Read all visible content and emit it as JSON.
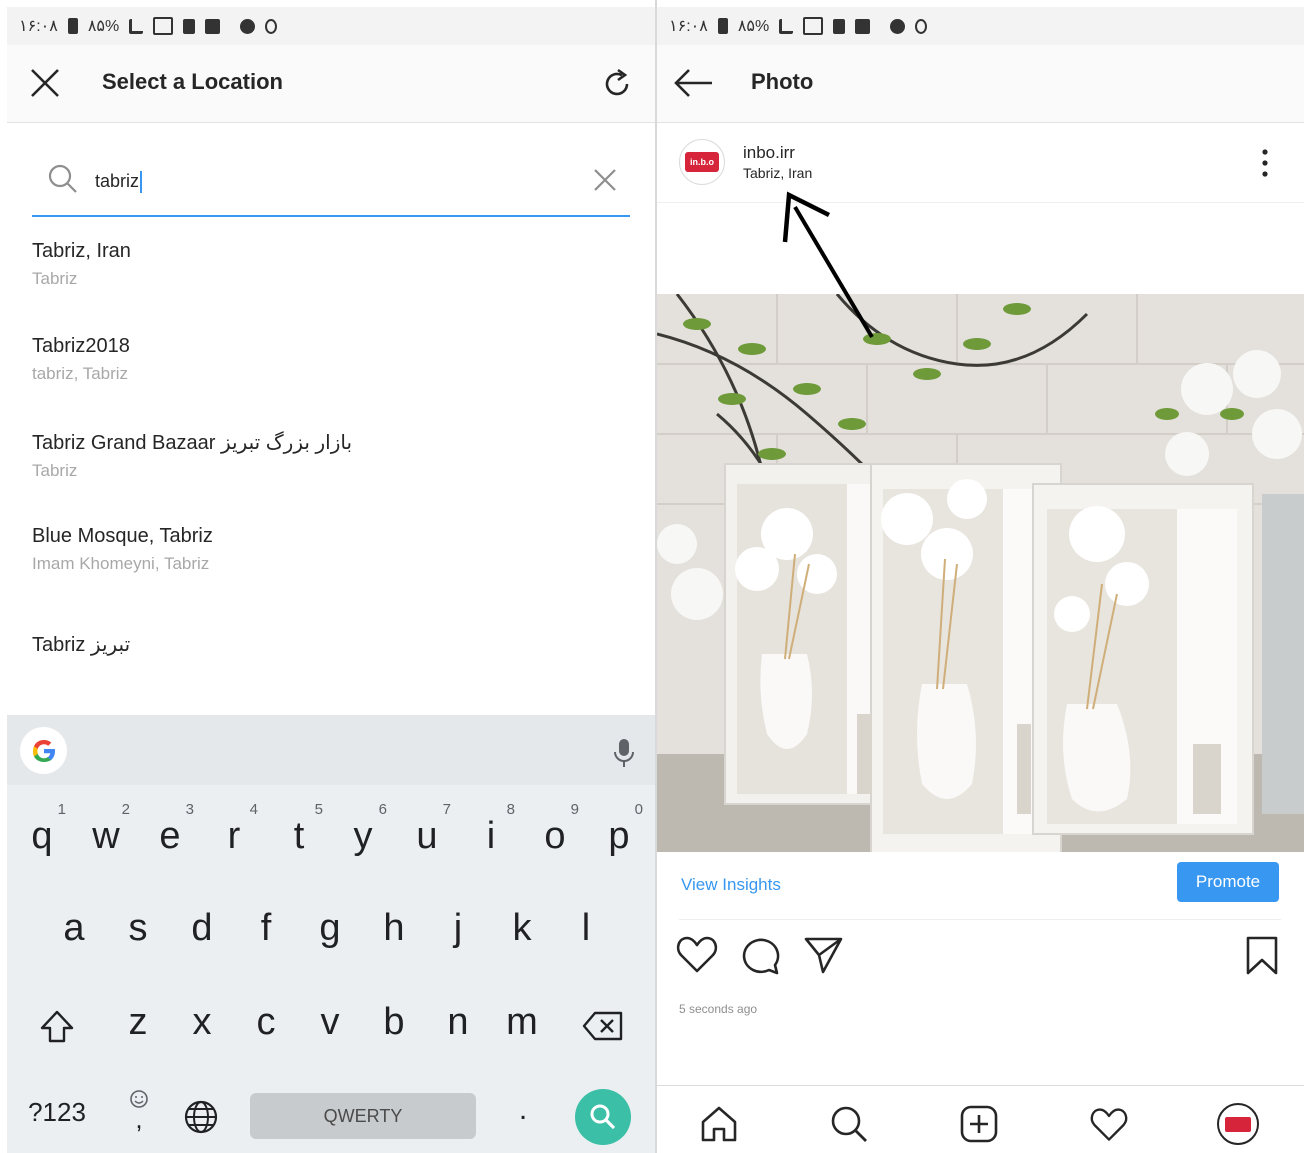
{
  "status_bar": {
    "time": "۱۶:۰۸",
    "battery": "۸۵%"
  },
  "location_screen": {
    "title": "Select a Location",
    "search": {
      "value": "tabriz"
    },
    "results": [
      {
        "name": "Tabriz, Iran",
        "subtitle": "Tabriz"
      },
      {
        "name": "Tabriz2018",
        "subtitle": "tabriz, Tabriz"
      },
      {
        "name": "Tabriz Grand Bazaar  بازار بزرگ تبریز",
        "subtitle": "Tabriz"
      },
      {
        "name": "Blue Mosque, Tabriz",
        "subtitle": "Imam Khomeyni, Tabriz"
      },
      {
        "name": "Tabriz  تبریز",
        "subtitle": ""
      }
    ]
  },
  "keyboard": {
    "row1": [
      {
        "k": "q",
        "n": "1"
      },
      {
        "k": "w",
        "n": "2"
      },
      {
        "k": "e",
        "n": "3"
      },
      {
        "k": "r",
        "n": "4"
      },
      {
        "k": "t",
        "n": "5"
      },
      {
        "k": "y",
        "n": "6"
      },
      {
        "k": "u",
        "n": "7"
      },
      {
        "k": "i",
        "n": "8"
      },
      {
        "k": "o",
        "n": "9"
      },
      {
        "k": "p",
        "n": "0"
      }
    ],
    "row2": [
      "a",
      "s",
      "d",
      "f",
      "g",
      "h",
      "j",
      "k",
      "l"
    ],
    "row3": [
      "z",
      "x",
      "c",
      "v",
      "b",
      "n",
      "m"
    ],
    "symbols_key": "?123",
    "comma_key": ",",
    "period_key": ".",
    "space_label": "QWERTY"
  },
  "photo_screen": {
    "title": "Photo",
    "username": "inbo.irr",
    "location": "Tabriz, Iran",
    "avatar_text": "in.b.o",
    "view_insights": "View Insights",
    "promote": "Promote",
    "time_ago": "5 seconds ago"
  },
  "colors": {
    "accent": "#3897f0",
    "search_key": "#3bbfa6",
    "brand_red": "#d6243b"
  }
}
